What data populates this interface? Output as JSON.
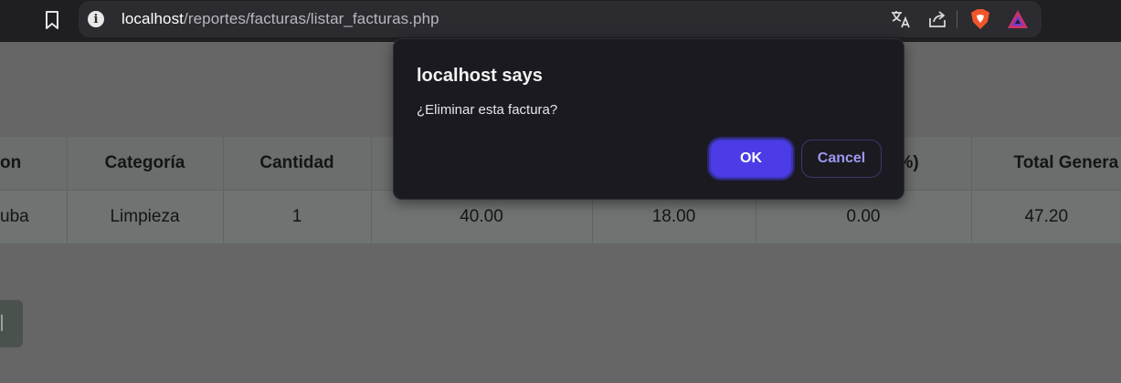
{
  "browser": {
    "url_host": "localhost",
    "url_path": "/reportes/facturas/listar_facturas.php",
    "icons": [
      "bookmark-icon",
      "site-info-icon",
      "translate-icon",
      "share-icon",
      "brave-shields-icon",
      "brave-rewards-icon"
    ]
  },
  "table": {
    "headers": [
      "on",
      "Categoría",
      "Cantidad",
      "",
      "",
      "%)",
      "Total Genera"
    ],
    "row": [
      "uba",
      "Limpieza",
      "1",
      "40.00",
      "18.00",
      "0.00",
      "47.20"
    ]
  },
  "dialog": {
    "title": "localhost says",
    "message": "¿Eliminar esta factura?",
    "ok_label": "OK",
    "cancel_label": "Cancel",
    "accent_color": "#4b3ce6"
  }
}
